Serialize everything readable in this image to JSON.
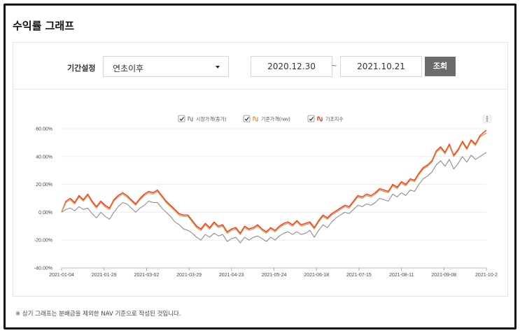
{
  "section_title": "수익률 그래프",
  "filter": {
    "period_label": "기간설정",
    "period_selected": "연초이후",
    "date_from": "2020.12.30",
    "date_sep": "~",
    "date_to": "2021.10.21",
    "search_button": "조회"
  },
  "legend": {
    "items": [
      {
        "label": "시장가격(종가)",
        "color": "#8c8c8c"
      },
      {
        "label": "기준가격(nav)",
        "color": "#f08c3a"
      },
      {
        "label": "기초지수",
        "color": "#e5321e"
      }
    ]
  },
  "footnote": "※ 상기 그래프는 분배금을 제외한 NAV 기준으로 작성된 것입니다.",
  "chart_data": {
    "type": "line",
    "ylim": [
      -40,
      60
    ],
    "yticks": [
      "-40.00%",
      "-20.00%",
      "0.00%",
      "20.00%",
      "40.00%",
      "60.00%"
    ],
    "xticks": [
      "2021-01-04",
      "2021-01-29",
      "2021-03-02",
      "2021-03-29",
      "2021-04-23",
      "2021-05-24",
      "2021-06-18",
      "2021-07-15",
      "2021-08-11",
      "2021-09-08",
      "2021-10-2"
    ],
    "x_index_max": 195,
    "series": [
      {
        "name": "기초지수",
        "color": "#e5321e",
        "points": [
          [
            0,
            0
          ],
          [
            2,
            8
          ],
          [
            4,
            10
          ],
          [
            6,
            7
          ],
          [
            8,
            12
          ],
          [
            10,
            9
          ],
          [
            12,
            13
          ],
          [
            14,
            8
          ],
          [
            16,
            4
          ],
          [
            18,
            8
          ],
          [
            20,
            5
          ],
          [
            22,
            3
          ],
          [
            24,
            9
          ],
          [
            26,
            12
          ],
          [
            28,
            14
          ],
          [
            30,
            12
          ],
          [
            32,
            9
          ],
          [
            34,
            6
          ],
          [
            36,
            10
          ],
          [
            38,
            13
          ],
          [
            40,
            15
          ],
          [
            42,
            14
          ],
          [
            44,
            16
          ],
          [
            46,
            12
          ],
          [
            48,
            8
          ],
          [
            50,
            5
          ],
          [
            52,
            2
          ],
          [
            54,
            -1
          ],
          [
            56,
            -2
          ],
          [
            58,
            -2
          ],
          [
            60,
            -6
          ],
          [
            62,
            -10
          ],
          [
            64,
            -12
          ],
          [
            66,
            -8
          ],
          [
            68,
            -11
          ],
          [
            70,
            -7
          ],
          [
            72,
            -10
          ],
          [
            74,
            -9
          ],
          [
            76,
            -14
          ],
          [
            78,
            -12
          ],
          [
            80,
            -11
          ],
          [
            82,
            -15
          ],
          [
            84,
            -10
          ],
          [
            86,
            -12
          ],
          [
            88,
            -11
          ],
          [
            90,
            -9
          ],
          [
            92,
            -12
          ],
          [
            94,
            -14
          ],
          [
            96,
            -11
          ],
          [
            98,
            -13
          ],
          [
            100,
            -10
          ],
          [
            102,
            -8
          ],
          [
            104,
            -7
          ],
          [
            106,
            -9
          ],
          [
            108,
            -6
          ],
          [
            110,
            -9
          ],
          [
            112,
            -8
          ],
          [
            114,
            -7
          ],
          [
            116,
            -11
          ],
          [
            118,
            -6
          ],
          [
            120,
            -2
          ],
          [
            122,
            -4
          ],
          [
            124,
            -1
          ],
          [
            126,
            1
          ],
          [
            128,
            3
          ],
          [
            130,
            5
          ],
          [
            132,
            4
          ],
          [
            134,
            8
          ],
          [
            136,
            12
          ],
          [
            138,
            11
          ],
          [
            140,
            13
          ],
          [
            142,
            12
          ],
          [
            144,
            14
          ],
          [
            146,
            17
          ],
          [
            148,
            16
          ],
          [
            150,
            15
          ],
          [
            152,
            20
          ],
          [
            154,
            18
          ],
          [
            156,
            22
          ],
          [
            158,
            20
          ],
          [
            160,
            24
          ],
          [
            162,
            23
          ],
          [
            164,
            28
          ],
          [
            166,
            32
          ],
          [
            168,
            34
          ],
          [
            170,
            37
          ],
          [
            172,
            44
          ],
          [
            174,
            47
          ],
          [
            176,
            43
          ],
          [
            178,
            49
          ],
          [
            180,
            41
          ],
          [
            182,
            45
          ],
          [
            184,
            51
          ],
          [
            186,
            46
          ],
          [
            188,
            52
          ],
          [
            190,
            49
          ],
          [
            192,
            55
          ],
          [
            195,
            59
          ]
        ]
      },
      {
        "name": "기준가격(nav)",
        "color": "#f08c3a",
        "points": [
          [
            0,
            0
          ],
          [
            2,
            7
          ],
          [
            4,
            9
          ],
          [
            6,
            6
          ],
          [
            8,
            11
          ],
          [
            10,
            8
          ],
          [
            12,
            12
          ],
          [
            14,
            7
          ],
          [
            16,
            3
          ],
          [
            18,
            7
          ],
          [
            20,
            4
          ],
          [
            22,
            2
          ],
          [
            24,
            8
          ],
          [
            26,
            11
          ],
          [
            28,
            13
          ],
          [
            30,
            11
          ],
          [
            32,
            8
          ],
          [
            34,
            5
          ],
          [
            36,
            9
          ],
          [
            38,
            12
          ],
          [
            40,
            14
          ],
          [
            42,
            13
          ],
          [
            44,
            15
          ],
          [
            46,
            11
          ],
          [
            48,
            7
          ],
          [
            50,
            4
          ],
          [
            52,
            1
          ],
          [
            54,
            -2
          ],
          [
            56,
            -3
          ],
          [
            58,
            -3
          ],
          [
            60,
            -7
          ],
          [
            62,
            -11
          ],
          [
            64,
            -13
          ],
          [
            66,
            -9
          ],
          [
            68,
            -12
          ],
          [
            70,
            -8
          ],
          [
            72,
            -11
          ],
          [
            74,
            -10
          ],
          [
            76,
            -15
          ],
          [
            78,
            -13
          ],
          [
            80,
            -12
          ],
          [
            82,
            -16
          ],
          [
            84,
            -11
          ],
          [
            86,
            -13
          ],
          [
            88,
            -12
          ],
          [
            90,
            -10
          ],
          [
            92,
            -13
          ],
          [
            94,
            -15
          ],
          [
            96,
            -12
          ],
          [
            98,
            -14
          ],
          [
            100,
            -11
          ],
          [
            102,
            -9
          ],
          [
            104,
            -8
          ],
          [
            106,
            -10
          ],
          [
            108,
            -7
          ],
          [
            110,
            -10
          ],
          [
            112,
            -9
          ],
          [
            114,
            -8
          ],
          [
            116,
            -12
          ],
          [
            118,
            -7
          ],
          [
            120,
            -3
          ],
          [
            122,
            -5
          ],
          [
            124,
            -2
          ],
          [
            126,
            0
          ],
          [
            128,
            2
          ],
          [
            130,
            4
          ],
          [
            132,
            3
          ],
          [
            134,
            7
          ],
          [
            136,
            11
          ],
          [
            138,
            10
          ],
          [
            140,
            12
          ],
          [
            142,
            11
          ],
          [
            144,
            13
          ],
          [
            146,
            16
          ],
          [
            148,
            15
          ],
          [
            150,
            14
          ],
          [
            152,
            19
          ],
          [
            154,
            17
          ],
          [
            156,
            21
          ],
          [
            158,
            19
          ],
          [
            160,
            23
          ],
          [
            162,
            22
          ],
          [
            164,
            27
          ],
          [
            166,
            31
          ],
          [
            168,
            33
          ],
          [
            170,
            36
          ],
          [
            172,
            43
          ],
          [
            174,
            46
          ],
          [
            176,
            42
          ],
          [
            178,
            48
          ],
          [
            180,
            40
          ],
          [
            182,
            44
          ],
          [
            184,
            50
          ],
          [
            186,
            45
          ],
          [
            188,
            51
          ],
          [
            190,
            48
          ],
          [
            192,
            54
          ],
          [
            195,
            57
          ]
        ]
      },
      {
        "name": "시장가격(종가)",
        "color": "#8c8c8c",
        "points": [
          [
            0,
            0
          ],
          [
            2,
            2
          ],
          [
            4,
            3
          ],
          [
            6,
            1
          ],
          [
            8,
            4
          ],
          [
            10,
            2
          ],
          [
            12,
            3
          ],
          [
            14,
            -1
          ],
          [
            16,
            -4
          ],
          [
            18,
            0
          ],
          [
            20,
            -3
          ],
          [
            22,
            -5
          ],
          [
            24,
            0
          ],
          [
            26,
            4
          ],
          [
            28,
            7
          ],
          [
            30,
            6
          ],
          [
            32,
            3
          ],
          [
            34,
            0
          ],
          [
            36,
            3
          ],
          [
            38,
            5
          ],
          [
            40,
            8
          ],
          [
            42,
            7
          ],
          [
            44,
            7
          ],
          [
            46,
            3
          ],
          [
            48,
            0
          ],
          [
            50,
            -3
          ],
          [
            52,
            -7
          ],
          [
            54,
            -9
          ],
          [
            56,
            -12
          ],
          [
            58,
            -13
          ],
          [
            60,
            -15
          ],
          [
            62,
            -18
          ],
          [
            64,
            -20
          ],
          [
            66,
            -16
          ],
          [
            68,
            -18
          ],
          [
            70,
            -15
          ],
          [
            72,
            -17
          ],
          [
            74,
            -16
          ],
          [
            76,
            -21
          ],
          [
            78,
            -19
          ],
          [
            80,
            -18
          ],
          [
            82,
            -22
          ],
          [
            84,
            -18
          ],
          [
            86,
            -20
          ],
          [
            88,
            -18
          ],
          [
            90,
            -17
          ],
          [
            92,
            -19
          ],
          [
            94,
            -21
          ],
          [
            96,
            -18
          ],
          [
            98,
            -20
          ],
          [
            100,
            -17
          ],
          [
            102,
            -15
          ],
          [
            104,
            -14
          ],
          [
            106,
            -16
          ],
          [
            108,
            -14
          ],
          [
            110,
            -16
          ],
          [
            112,
            -15
          ],
          [
            114,
            -13
          ],
          [
            116,
            -18
          ],
          [
            118,
            -13
          ],
          [
            120,
            -9
          ],
          [
            122,
            -11
          ],
          [
            124,
            -7
          ],
          [
            126,
            -4
          ],
          [
            128,
            -2
          ],
          [
            130,
            0
          ],
          [
            132,
            -1
          ],
          [
            134,
            2
          ],
          [
            136,
            5
          ],
          [
            138,
            4
          ],
          [
            140,
            6
          ],
          [
            142,
            5
          ],
          [
            144,
            7
          ],
          [
            146,
            10
          ],
          [
            148,
            9
          ],
          [
            150,
            8
          ],
          [
            152,
            13
          ],
          [
            154,
            11
          ],
          [
            156,
            14
          ],
          [
            158,
            12
          ],
          [
            160,
            16
          ],
          [
            162,
            15
          ],
          [
            164,
            20
          ],
          [
            166,
            24
          ],
          [
            168,
            26
          ],
          [
            170,
            29
          ],
          [
            172,
            34
          ],
          [
            174,
            37
          ],
          [
            176,
            33
          ],
          [
            178,
            38
          ],
          [
            180,
            31
          ],
          [
            182,
            35
          ],
          [
            184,
            40
          ],
          [
            186,
            36
          ],
          [
            188,
            41
          ],
          [
            190,
            38
          ],
          [
            192,
            40
          ],
          [
            195,
            43
          ]
        ]
      }
    ]
  }
}
